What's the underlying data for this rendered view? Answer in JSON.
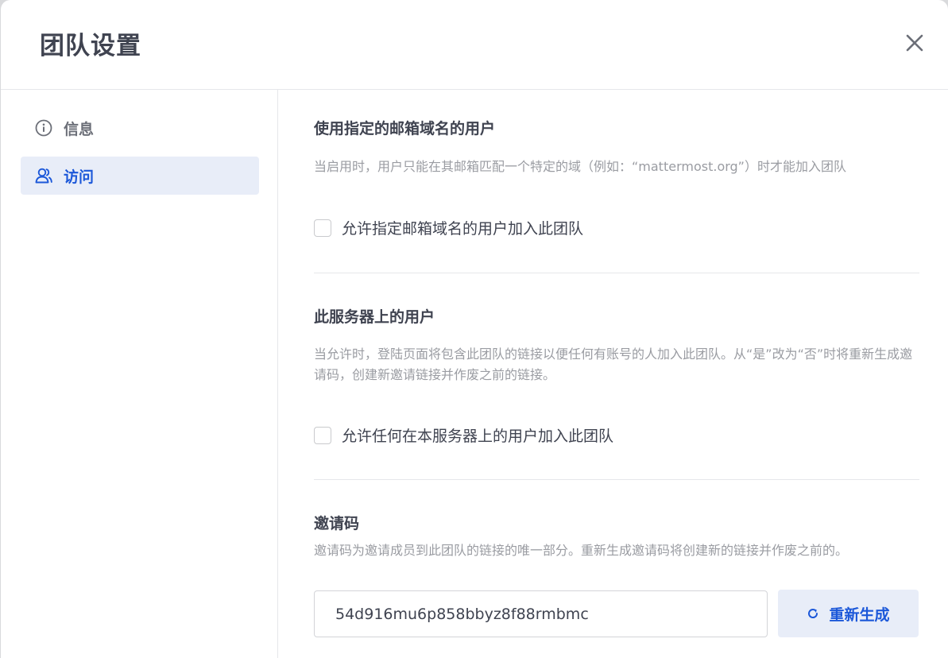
{
  "modal": {
    "title": "团队设置"
  },
  "sidebar": {
    "items": [
      {
        "label": "信息",
        "icon": "info-circle-icon",
        "active": false
      },
      {
        "label": "访问",
        "icon": "users-icon",
        "active": true
      }
    ]
  },
  "sections": {
    "email_domain": {
      "title": "使用指定的邮箱域名的用户",
      "description": "当启用时，用户只能在其邮箱匹配一个特定的域（例如：“mattermost.org”）时才能加入团队",
      "checkbox_label": "允许指定邮箱域名的用户加入此团队",
      "checked": false
    },
    "server_users": {
      "title": "此服务器上的用户",
      "description": "当允许时，登陆页面将包含此团队的链接以便任何有账号的人加入此团队。从“是”改为“否”时将重新生成邀请码，创建新邀请链接并作废之前的链接。",
      "checkbox_label": "允许任何在本服务器上的用户加入此团队",
      "checked": false
    },
    "invite_code": {
      "title": "邀请码",
      "description": "邀请码为邀请成员到此团队的链接的唯一部分。重新生成邀请码将创建新的链接并作废之前的。",
      "value": "54d916mu6p858bbyz8f88rmbmc",
      "regenerate_label": "重新生成"
    }
  },
  "colors": {
    "accent": "#1c58d9",
    "accent_bg": "#e8edf8",
    "text": "#3f4350",
    "muted": "#9a9ca2"
  }
}
